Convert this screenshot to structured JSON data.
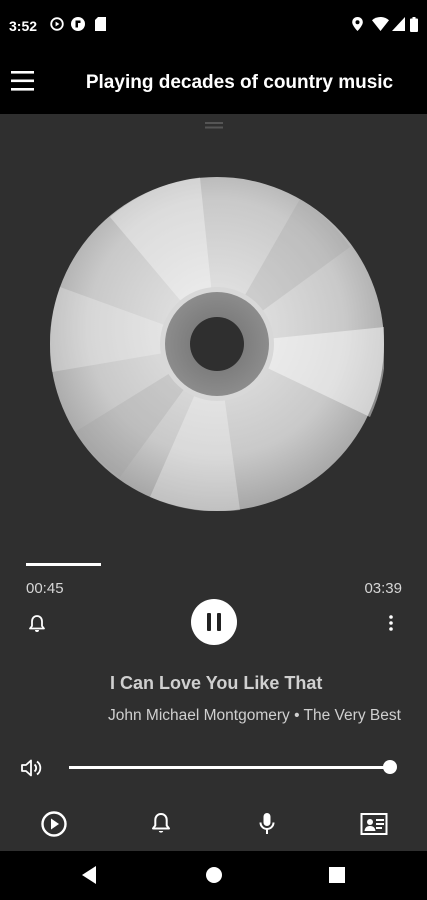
{
  "status_bar": {
    "time": "3:52",
    "icons": [
      "play-circle-icon",
      "flipboard-icon",
      "sd-card-icon",
      "location-icon",
      "wifi-icon",
      "signal-icon",
      "battery-icon"
    ]
  },
  "app_bar": {
    "title": "Playing decades of country music",
    "menu_icon": "hamburger-menu-icon"
  },
  "player": {
    "elapsed": "00:45",
    "duration": "03:39",
    "progress_fraction": 0.2,
    "is_playing": true,
    "track_title": "I Can Love You Like That",
    "track_subtitle": "John Michael Montgomery • The Very Best",
    "volume_fraction": 1.0
  },
  "bottom_bar": {
    "icons": [
      "play-circle-icon",
      "bell-icon",
      "microphone-icon",
      "contact-card-icon"
    ]
  },
  "nav_bar": {
    "icons": [
      "back-icon",
      "home-icon",
      "recents-icon"
    ]
  },
  "colors": {
    "background": "#2f2f2f",
    "bars": "#000000",
    "accent": "#ffffff"
  }
}
